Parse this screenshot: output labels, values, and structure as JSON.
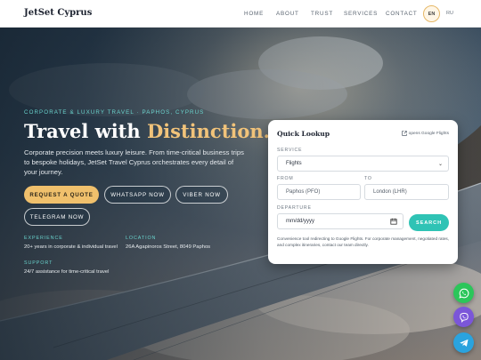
{
  "header": {
    "brand": "JetSet Cyprus",
    "nav": [
      "HOME",
      "ABOUT",
      "TRUST",
      "SERVICES",
      "CONTACT"
    ],
    "lang_active": "EN",
    "lang_other": "RU"
  },
  "hero": {
    "eyebrow": "CORPORATE & LUXURY TRAVEL · PAPHOS, CYPRUS",
    "title_main": "Travel with ",
    "title_highlight": "Distinction.",
    "lead": "Corporate precision meets luxury leisure. From time-critical business trips to bespoke holidays, JetSet Travel Cyprus orchestrates every detail of your journey.",
    "buttons": {
      "quote": "REQUEST A QUOTE",
      "whatsapp": "WHATSAPP NOW",
      "viber": "VIBER NOW",
      "telegram": "TELEGRAM NOW"
    },
    "info": {
      "experience_label": "EXPERIENCE",
      "experience_value": "20+ years in corporate & individual travel",
      "location_label": "LOCATION",
      "location_value": "26A Agapinoros Street, 8049 Paphos",
      "support_label": "SUPPORT",
      "support_value": "24/7 assistance for time-critical travel"
    }
  },
  "lookup": {
    "title": "Quick Lookup",
    "external_link": "opens Google Flights",
    "service_label": "SERVICE",
    "service_value": "Flights",
    "from_label": "FROM",
    "from_value": "Paphos (PFO)",
    "to_label": "TO",
    "to_value": "London (LHR)",
    "departure_label": "DEPARTURE",
    "departure_placeholder": "mm/dd/yyyy",
    "search_label": "SEARCH",
    "note": "Convenience tool redirecting to Google Flights. For corporate management, negotiated rates, and complex itineraries, contact our team directly."
  },
  "colors": {
    "accent_gold": "#f0c06c",
    "accent_teal": "#2fc3b5",
    "whatsapp": "#2bc65a",
    "viber": "#7b56d9",
    "telegram": "#2aa3de"
  },
  "icons": [
    "external-link-icon",
    "chevron-down-icon",
    "calendar-icon",
    "whatsapp-icon",
    "viber-icon",
    "telegram-icon"
  ]
}
